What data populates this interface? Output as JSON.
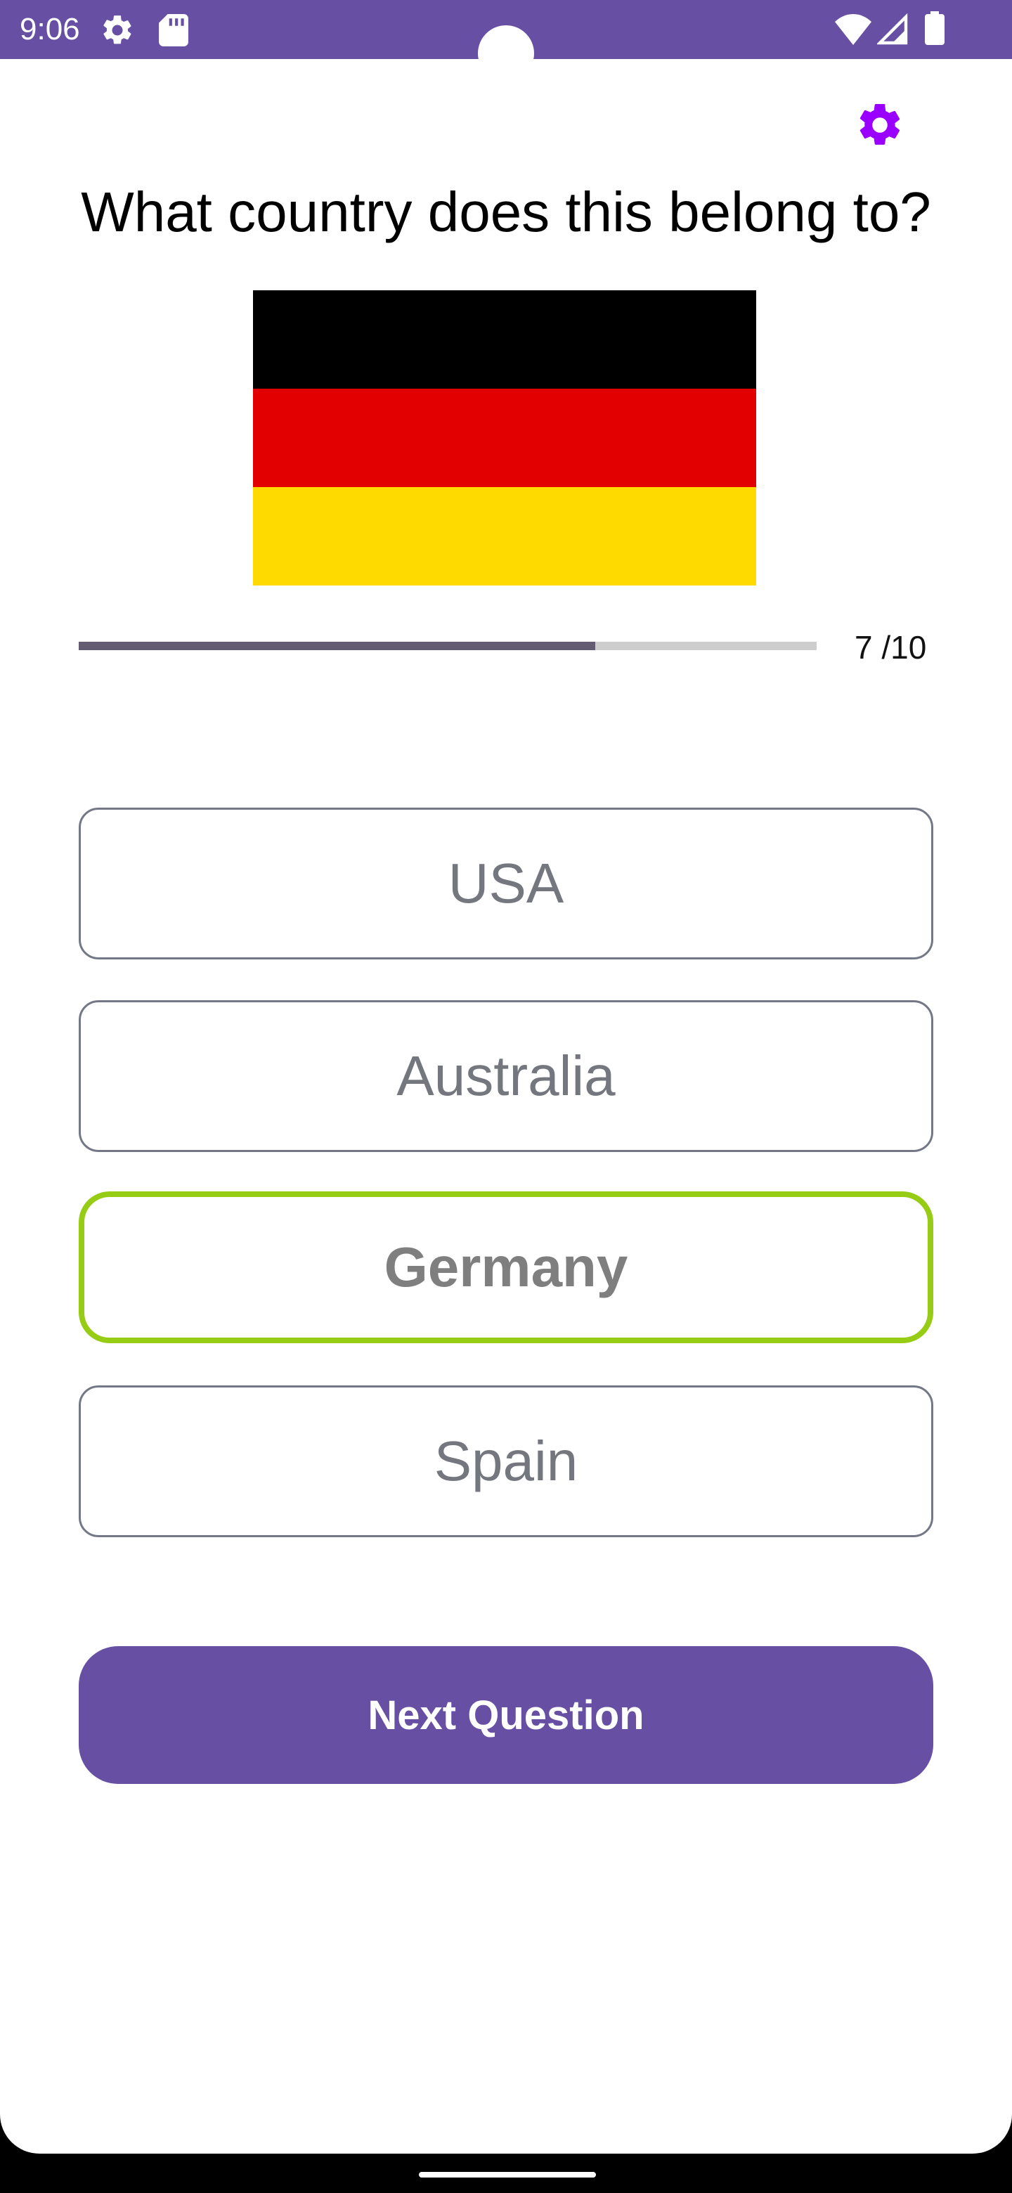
{
  "status_bar": {
    "time": "9:06",
    "icons": [
      "settings-icon",
      "sd-card-icon",
      "wifi-icon",
      "signal-icon",
      "battery-icon"
    ],
    "background": "#6750A4"
  },
  "quiz": {
    "question": "What country does this belong to?",
    "flag": {
      "country": "Germany",
      "colors": [
        "#000000",
        "#E30000",
        "#FFDA00"
      ]
    },
    "progress": {
      "current": 7,
      "total": 10,
      "fraction": 0.7,
      "label": "7 /10"
    },
    "options": [
      {
        "label": "USA",
        "state": "default"
      },
      {
        "label": "Australia",
        "state": "default"
      },
      {
        "label": "Germany",
        "state": "correct"
      },
      {
        "label": "Spain",
        "state": "default"
      }
    ],
    "next_button_label": "Next Question"
  },
  "colors": {
    "primary": "#6750A4",
    "correct_border": "#96CC14",
    "settings_icon": "#9900FF"
  }
}
